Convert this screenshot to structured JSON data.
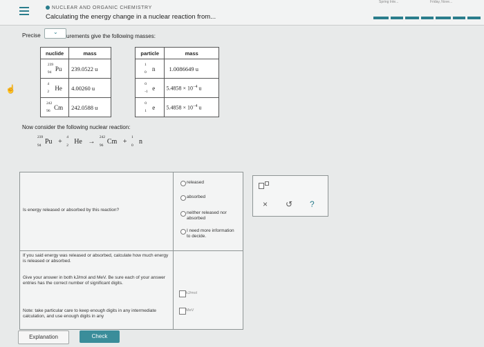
{
  "header": {
    "breadcrumb": "NUCLEAR AND ORGANIC CHEMISTRY",
    "title": "Calculating the energy change in a nuclear reaction from...",
    "top_right_1": "Spring Inte...",
    "top_right_2": "Friday, Nove..."
  },
  "intro": {
    "precise_label": "Precise",
    "dropdown_arrow": "⌄",
    "prompt_suffix": "urements give the following masses:"
  },
  "nuclide_table": {
    "headers": [
      "nuclide",
      "mass"
    ],
    "rows": [
      {
        "a": "239",
        "z": "94",
        "sym": "Pu",
        "mass": "239.0522 u"
      },
      {
        "a": "4",
        "z": "2",
        "sym": "He",
        "mass": "4.00260 u"
      },
      {
        "a": "242",
        "z": "96",
        "sym": "Cm",
        "mass": "242.0588 u"
      }
    ]
  },
  "particle_table": {
    "headers": [
      "particle",
      "mass"
    ],
    "rows": [
      {
        "a": "1",
        "z": "0",
        "sym": "n",
        "mass": "1.0086649 u"
      },
      {
        "a": "0",
        "z": "-1",
        "sym": "e",
        "mass": "5.4858 × 10",
        "exp": "−4",
        "unit": "u"
      },
      {
        "a": "0",
        "z": "1",
        "sym": "e",
        "mass": "5.4858 × 10",
        "exp": "−4",
        "unit": "u"
      }
    ]
  },
  "reaction": {
    "consider": "Now consider the following nuclear reaction:",
    "terms": [
      {
        "a": "239",
        "z": "94",
        "sym": "Pu"
      },
      {
        "a": "4",
        "z": "2",
        "sym": "He"
      },
      {
        "a": "242",
        "z": "96",
        "sym": "Cm"
      },
      {
        "a": "1",
        "z": "0",
        "sym": "n"
      }
    ],
    "plus": "+",
    "arrow": "→"
  },
  "question": {
    "q1": "Is energy released or absorbed by this reaction?",
    "options": [
      "released",
      "absorbed",
      "neither released nor absorbed",
      "I need more information to decide."
    ],
    "q2": "If you said energy was released or absorbed, calculate how much energy is released or absorbed.",
    "q3": "Give your answer in both kJ/mol and MeV. Be sure each of your answer entries has the correct number of significant digits.",
    "q4": "Note: take particular care to keep enough digits in any intermediate calculation, and use enough digits in any",
    "unit_kj": "kJ/mol",
    "unit_mev": "MeV"
  },
  "tools": {
    "x10": "x10",
    "close": "×",
    "undo": "↺",
    "help": "?"
  },
  "footer": {
    "explanation": "Explanation",
    "check": "Check"
  },
  "colors": {
    "accent": "#2a7d8c",
    "check": "#3a8d9a"
  }
}
